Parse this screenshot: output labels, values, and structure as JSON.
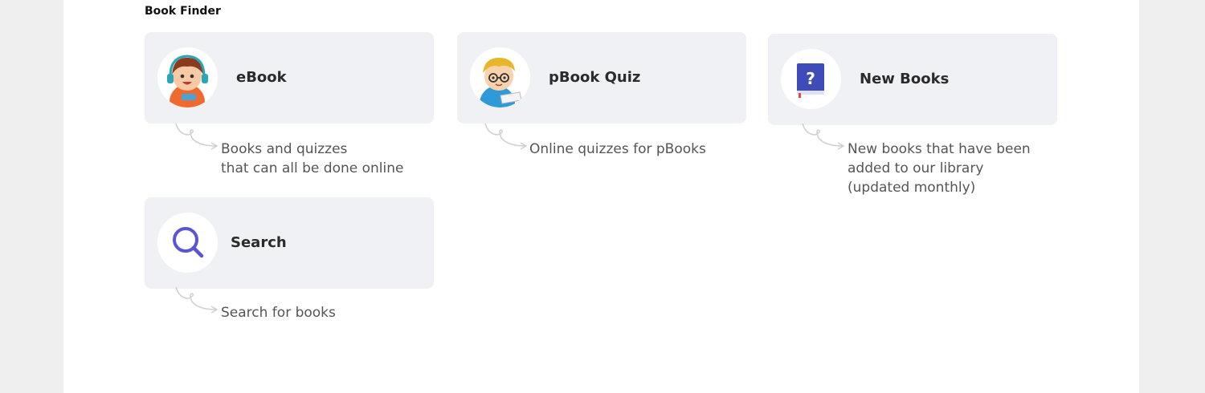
{
  "section": {
    "title": "Book Finder"
  },
  "cards": [
    {
      "label": "eBook",
      "icon": "kid-headphones-icon",
      "description": "Books and quizzes\nthat can all be done online"
    },
    {
      "label": "pBook Quiz",
      "icon": "kid-reading-icon",
      "description": "Online quizzes for pBooks"
    },
    {
      "label": "New Books",
      "icon": "question-book-icon",
      "description": "New books that have been\nadded to our library\n(updated monthly)"
    },
    {
      "label": "Search",
      "icon": "magnifier-icon",
      "description": "Search for books"
    }
  ],
  "colors": {
    "card_bg": "#f0f1f4",
    "accent": "#5a55d6",
    "text": "#2b2b2b",
    "desc": "#555555"
  }
}
